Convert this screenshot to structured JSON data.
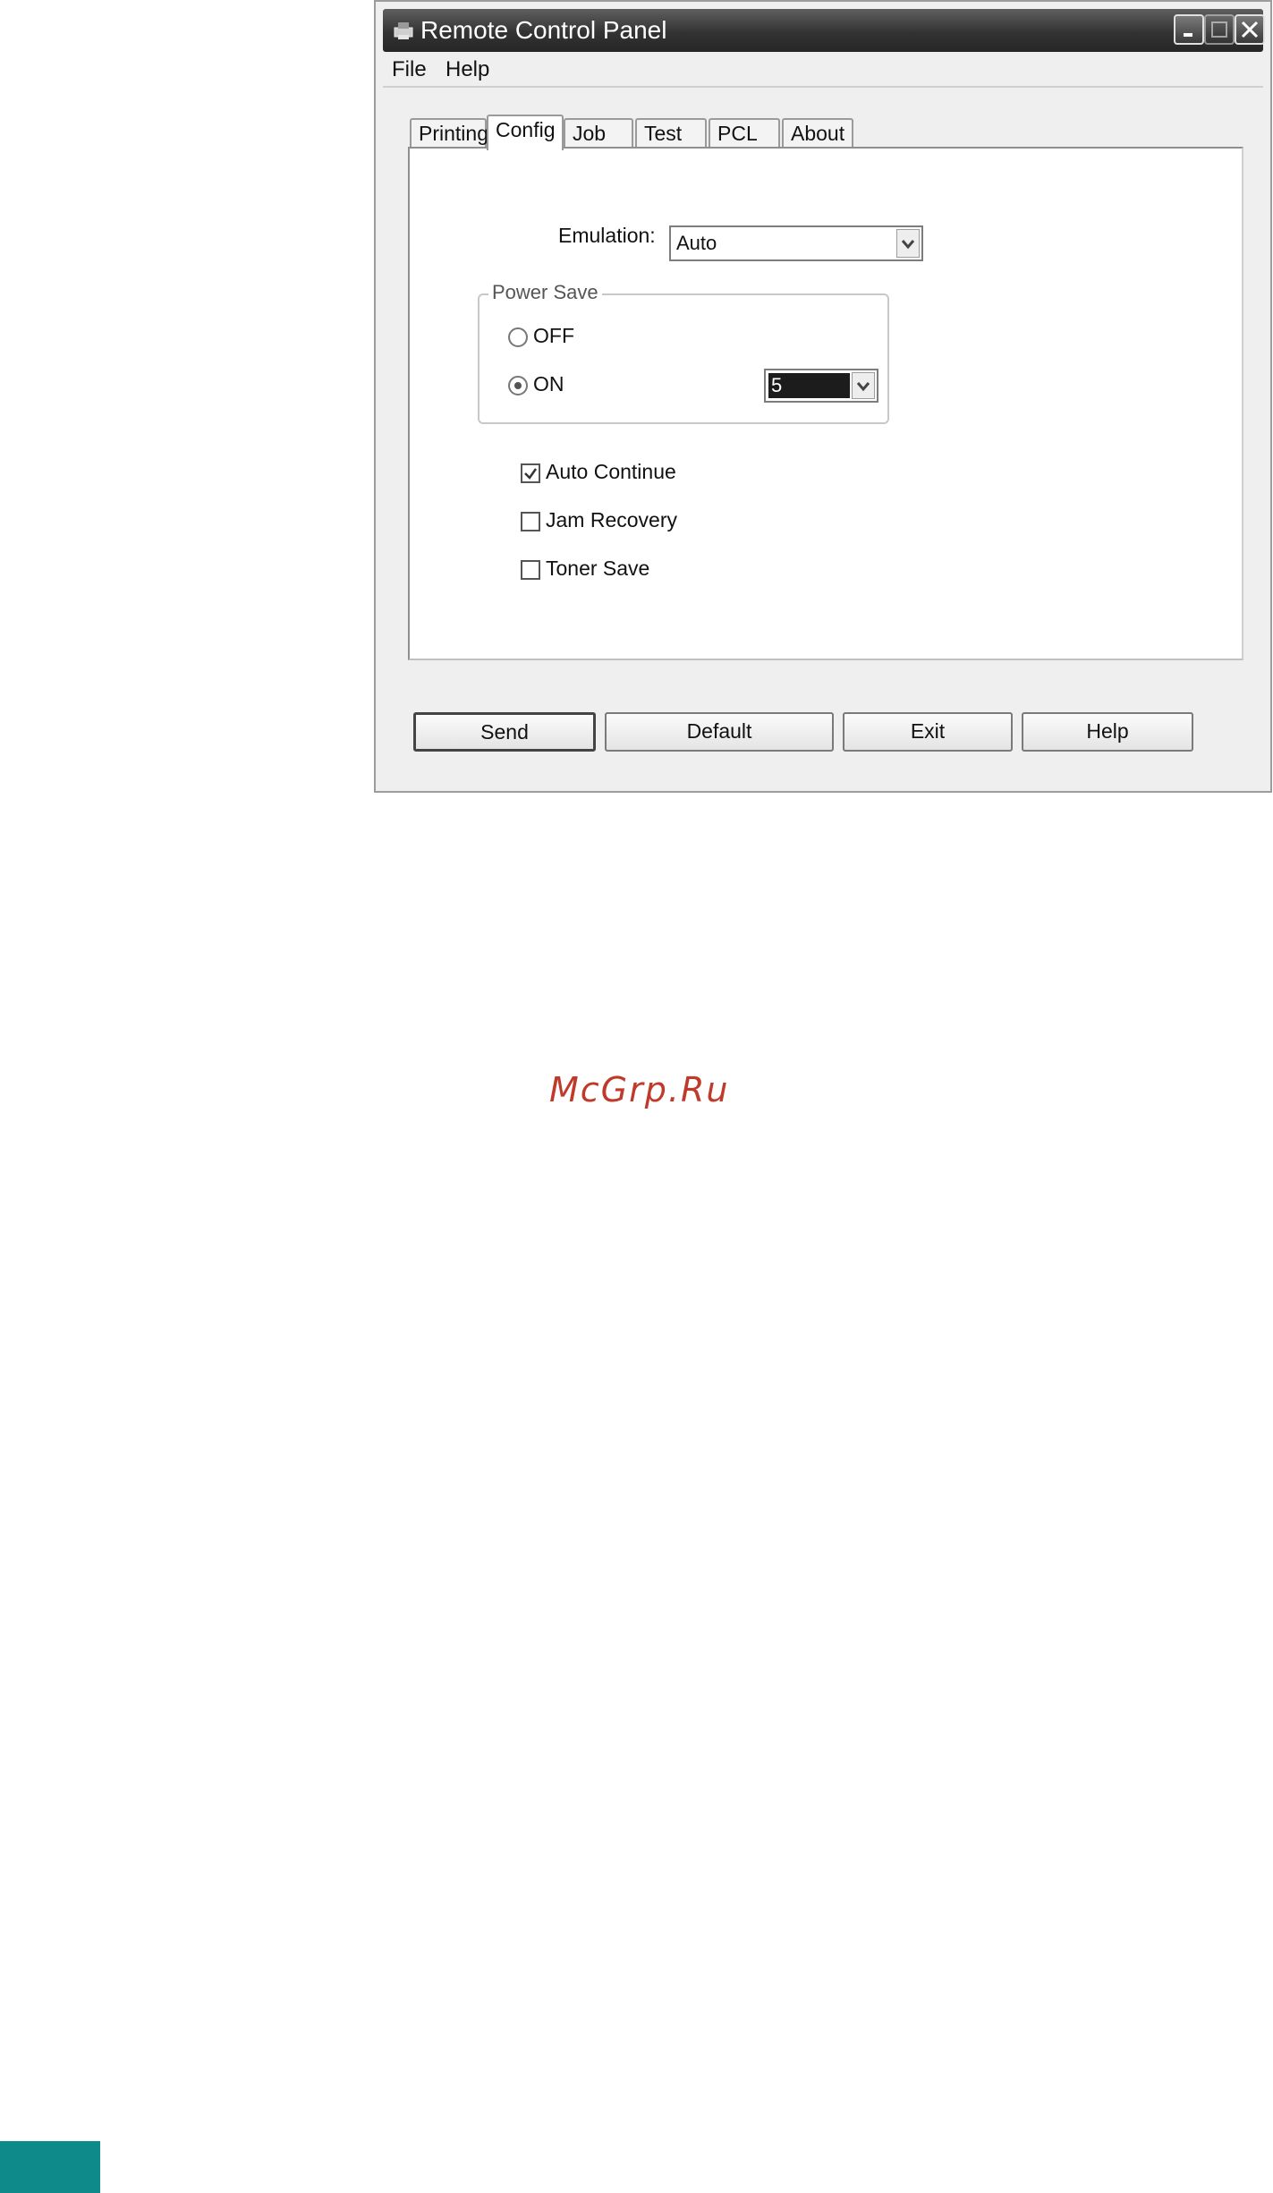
{
  "window": {
    "title": "Remote Control Panel",
    "controls": [
      "minimize",
      "maximize",
      "close"
    ]
  },
  "menu": {
    "items": [
      "File",
      "Help"
    ]
  },
  "tabs": {
    "items": [
      "Printing",
      "Config",
      "Job",
      "Test",
      "PCL",
      "About"
    ],
    "active": "Config"
  },
  "config": {
    "emulation_label": "Emulation:",
    "emulation_value": "Auto",
    "power_save": {
      "title": "Power Save",
      "off_label": "OFF",
      "on_label": "ON",
      "selected": "ON",
      "timeout_value": "5"
    },
    "options": [
      {
        "label": "Auto Continue",
        "checked": true
      },
      {
        "label": "Jam Recovery",
        "checked": false
      },
      {
        "label": "Toner Save",
        "checked": false
      }
    ]
  },
  "buttons": {
    "send": "Send",
    "default": "Default",
    "exit": "Exit",
    "help": "Help"
  },
  "watermark": "McGrp.Ru",
  "colors": {
    "accent_block": "#0f8a8a",
    "watermark": "#c03a2b"
  }
}
